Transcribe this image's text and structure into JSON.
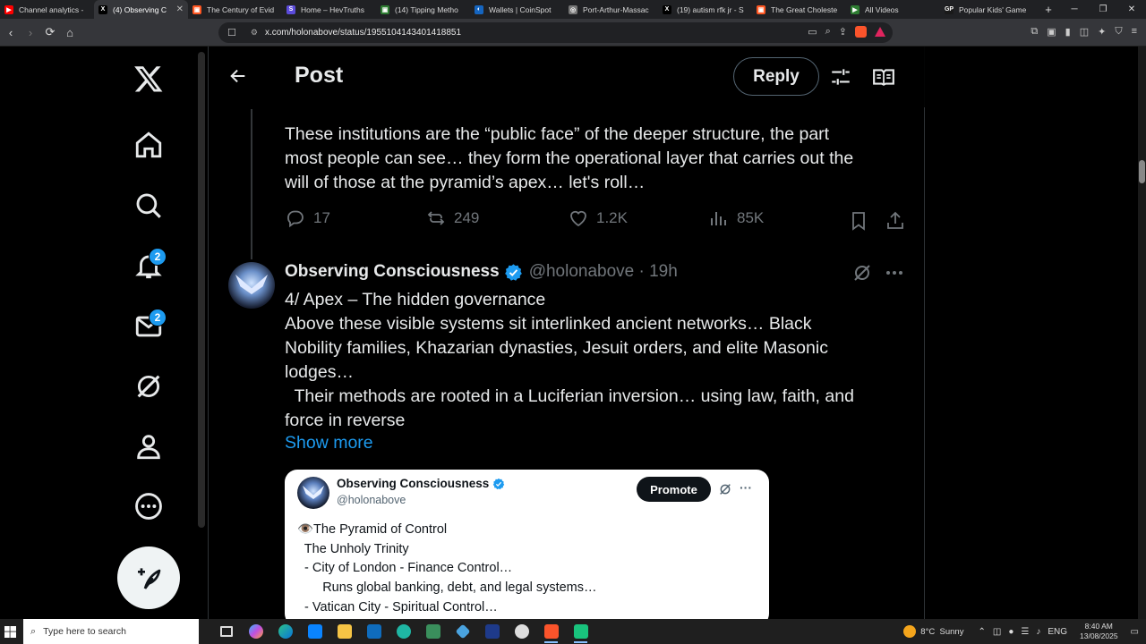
{
  "browser": {
    "tabs": [
      {
        "label": "Channel analytics - ",
        "color": "#ff0000",
        "glyph": "▶"
      },
      {
        "label": "(4) Observing C",
        "color": "#000000",
        "glyph": "X",
        "active": true
      },
      {
        "label": "The Century of Evid",
        "color": "#ff5722",
        "glyph": "▣"
      },
      {
        "label": "Home – HevTruths",
        "color": "#5b4bdb",
        "glyph": "S"
      },
      {
        "label": "(14) Tipping Metho",
        "color": "#2e7d32",
        "glyph": "▣"
      },
      {
        "label": "Wallets | CoinSpot",
        "color": "#1565c0",
        "glyph": "◐"
      },
      {
        "label": "Port-Arthur-Massac",
        "color": "#777777",
        "glyph": "◎"
      },
      {
        "label": "(19) autism rfk jr - S",
        "color": "#000000",
        "glyph": "X"
      },
      {
        "label": "The Great Choleste",
        "color": "#ff5722",
        "glyph": "▣"
      },
      {
        "label": "All Videos",
        "color": "#2e7d32",
        "glyph": "▶"
      },
      {
        "label": "Popular Kids' Game",
        "color": "#1a1a1a",
        "glyph": "GP"
      }
    ],
    "new_tab_glyph": "+",
    "window_controls": [
      "─",
      "❐",
      "✕"
    ],
    "url": "x.com/holonabove/status/1955104143401418851"
  },
  "nav": {
    "notifications_count": "2",
    "messages_count": "2"
  },
  "header": {
    "title": "Post",
    "reply_label": "Reply"
  },
  "tweet1": {
    "lines": [
      "These institutions are the “public face” of the deeper structure, the part",
      "most people can see… they form the operational layer that carries out the",
      "will of those at the pyramid’s apex… let's roll…"
    ],
    "replies": "17",
    "reposts": "249",
    "likes": "1.2K",
    "views": "85K"
  },
  "tweet2": {
    "display_name": "Observing Consciousness",
    "handle": "@holonabove · 19h",
    "lines": [
      "4/ Apex – The hidden governance",
      "Above these visible systems sit interlinked ancient networks… Black",
      "Nobility families, Khazarian dynasties, Jesuit orders, and elite Masonic",
      "lodges…",
      "  Their methods are rooted in a Luciferian inversion… using law, faith, and",
      "force in reverse"
    ],
    "show_more": "Show more",
    "card": {
      "display_name": "Observing Consciousness",
      "handle": "@holonabove",
      "promote_label": "Promote",
      "lines": [
        "👁️The Pyramid of Control",
        "  The Unholy Trinity",
        "  - City of London - Finance Control…",
        "       Runs global banking, debt, and legal systems…",
        "  - Vatican City - Spiritual Control…"
      ]
    }
  },
  "taskbar": {
    "search_placeholder": "Type here to search",
    "weather": "8°C  Sunny",
    "language": "ENG",
    "time": "8:40 AM",
    "date": "13/08/2025"
  },
  "colors": {
    "accent": "#1d9bf0",
    "text": "#e7e9ea",
    "muted": "#71767b"
  }
}
